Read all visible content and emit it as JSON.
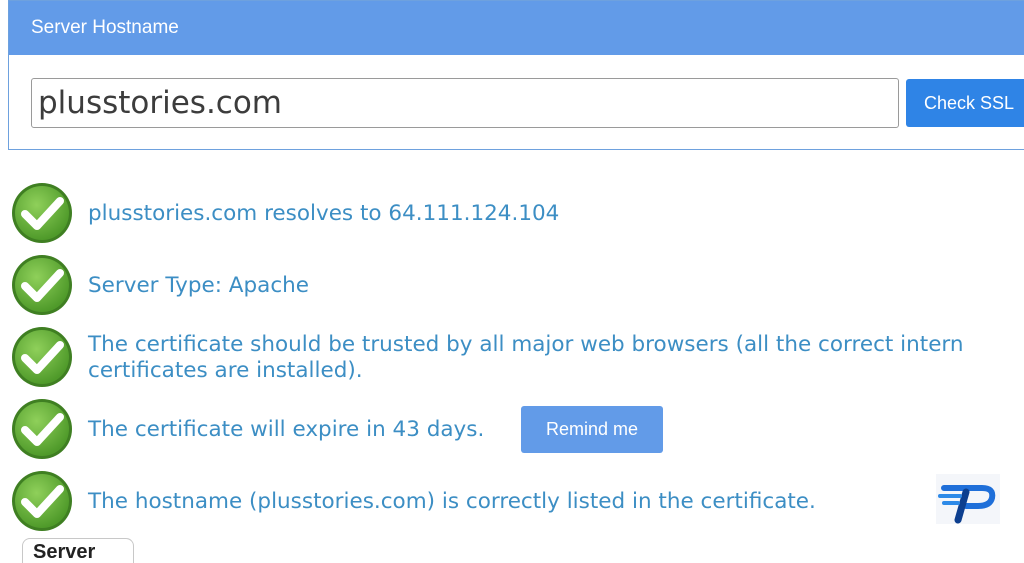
{
  "panel": {
    "header": "Server Hostname",
    "input_value": "plusstories.com",
    "check_button": "Check SSL"
  },
  "results": [
    {
      "line1": "plusstories.com resolves to 64.111.124.104",
      "line2": ""
    },
    {
      "line1": "Server Type: Apache",
      "line2": ""
    },
    {
      "line1": "The certificate should be trusted by all major web browsers (all the correct intern",
      "line2": "certificates are installed)."
    },
    {
      "line1": "The certificate will expire in 43 days.",
      "line2": ""
    },
    {
      "line1": "The hostname (plusstories.com) is correctly listed in the certificate.",
      "line2": ""
    }
  ],
  "remind_button": "Remind me",
  "bottom_tab": "Server",
  "colors": {
    "header_bg": "#629be8",
    "button_blue": "#2f84e6",
    "result_text": "#3c8ec4",
    "check_green": "#6cb33f"
  },
  "icons": {
    "check": "checkmark-circle-icon",
    "logo": "site-logo-icon"
  }
}
